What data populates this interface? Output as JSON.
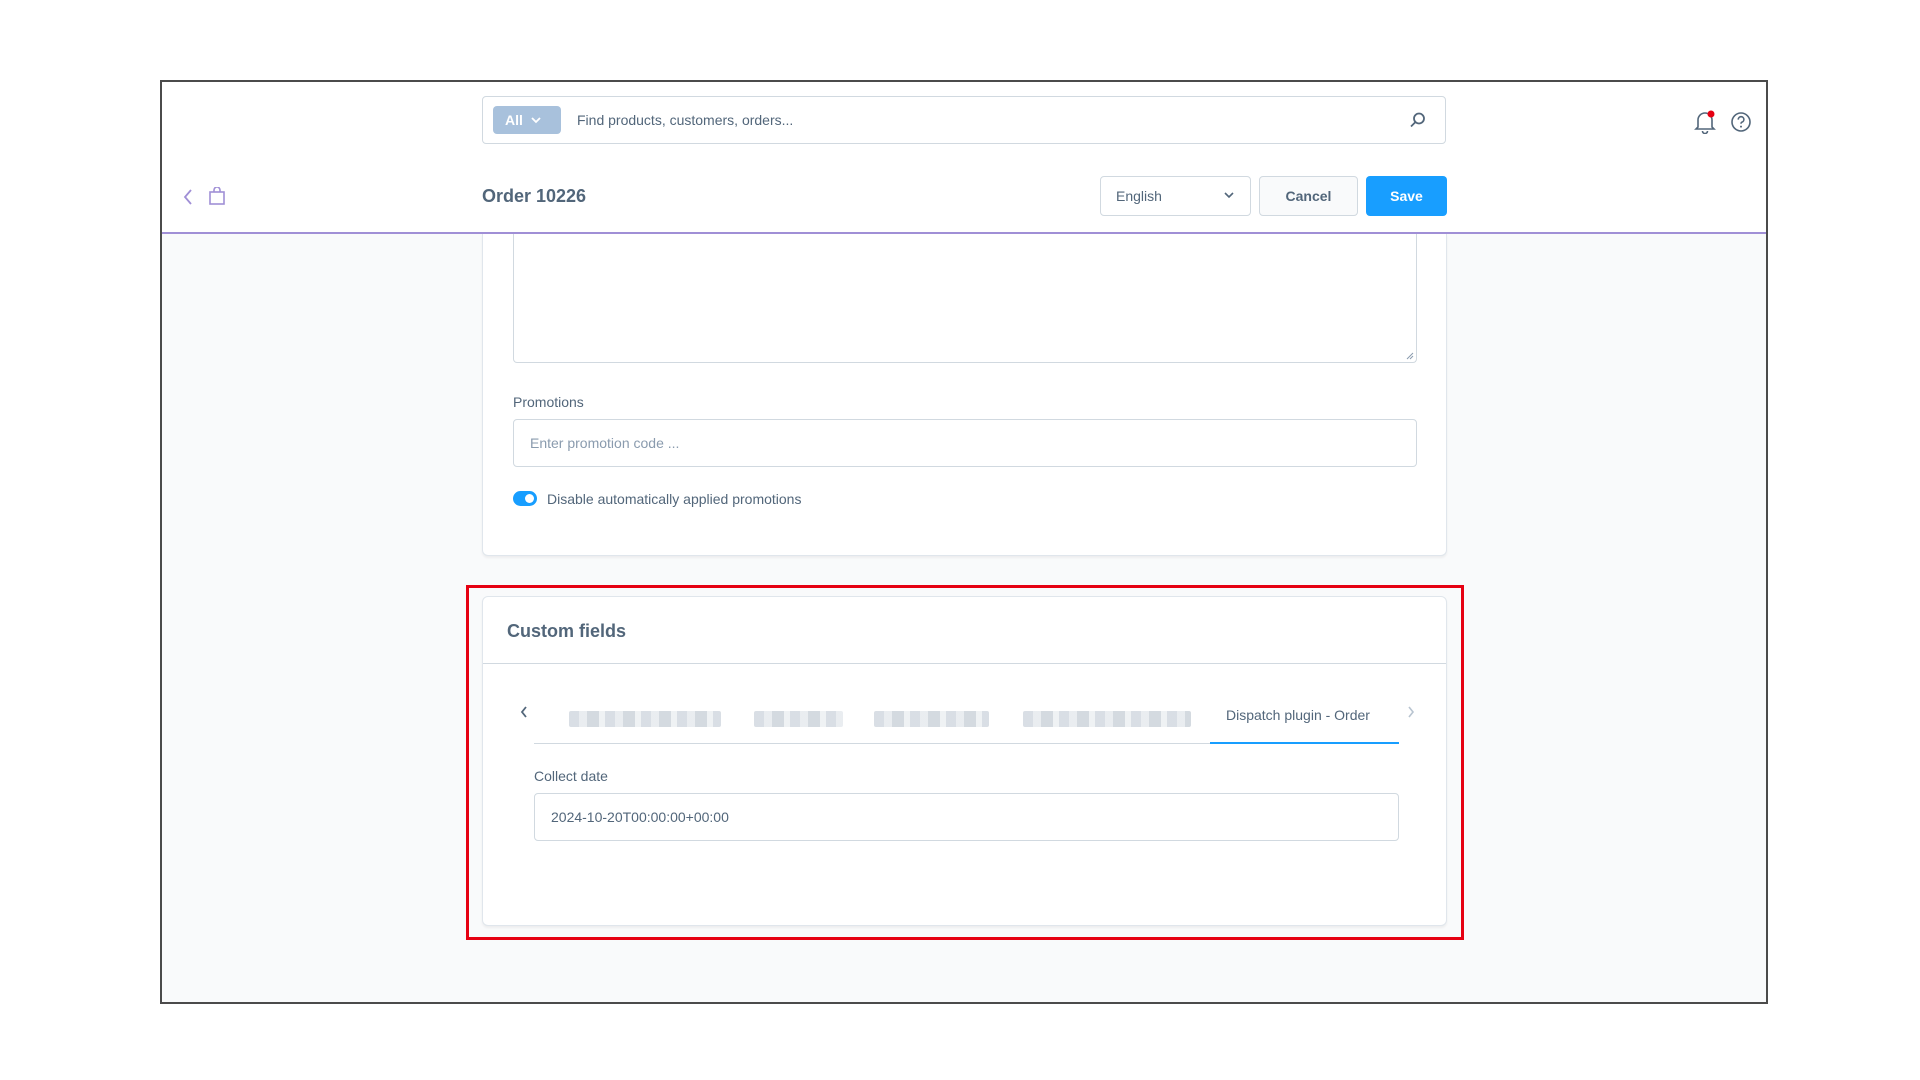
{
  "topbar": {
    "search_scope": "All",
    "search_placeholder": "Find products, customers, orders..."
  },
  "header": {
    "title": "Order 10226",
    "language": "English",
    "cancel_label": "Cancel",
    "save_label": "Save"
  },
  "details": {
    "promotions_label": "Promotions",
    "promotions_placeholder": "Enter promotion code ...",
    "disable_auto_promotions_label": "Disable automatically applied promotions",
    "disable_auto_promotions_on": true
  },
  "custom_fields": {
    "title": "Custom fields",
    "tabs": [
      {
        "label": "",
        "blurred": true
      },
      {
        "label": "",
        "blurred": true
      },
      {
        "label": "",
        "blurred": true
      },
      {
        "label": "",
        "blurred": true
      },
      {
        "label": "Dispatch plugin - Order",
        "active": true
      }
    ],
    "collect_date_label": "Collect date",
    "collect_date_value": "2024-10-20T00:00:00+00:00"
  },
  "colors": {
    "primary": "#189eff",
    "highlight": "#e60012",
    "notification_dot": "#e60012"
  }
}
